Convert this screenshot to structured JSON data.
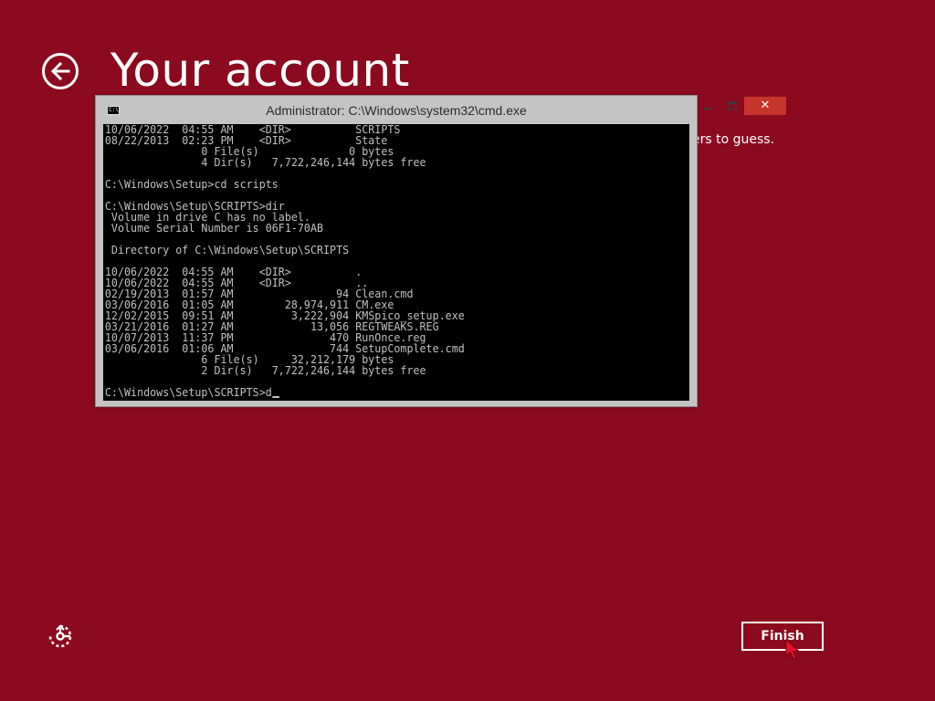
{
  "page": {
    "title": "Your account",
    "behind_text": "ers to guess.",
    "finish_label": "Finish"
  },
  "cmd": {
    "title": "Administrator: C:\\Windows\\system32\\cmd.exe",
    "icon_text": "C:\\",
    "close_glyph": "✕",
    "lines": [
      "10/06/2022  04:55 AM    <DIR>          SCRIPTS",
      "08/22/2013  02:23 PM    <DIR>          State",
      "               0 File(s)              0 bytes",
      "               4 Dir(s)   7,722,246,144 bytes free",
      "",
      "C:\\Windows\\Setup>cd scripts",
      "",
      "C:\\Windows\\Setup\\SCRIPTS>dir",
      " Volume in drive C has no label.",
      " Volume Serial Number is 06F1-70AB",
      "",
      " Directory of C:\\Windows\\Setup\\SCRIPTS",
      "",
      "10/06/2022  04:55 AM    <DIR>          .",
      "10/06/2022  04:55 AM    <DIR>          ..",
      "02/19/2013  01:57 AM                94 Clean.cmd",
      "03/06/2016  01:05 AM        28,974,911 CM.exe",
      "12/02/2015  09:51 AM         3,222,904 KMSpico_setup.exe",
      "03/21/2016  01:27 AM            13,056 REGTWEAKS.REG",
      "10/07/2013  11:37 PM               470 RunOnce.reg",
      "03/06/2016  01:06 AM               744 SetupComplete.cmd",
      "               6 File(s)     32,212,179 bytes",
      "               2 Dir(s)   7,722,246,144 bytes free",
      "",
      "C:\\Windows\\Setup\\SCRIPTS>d"
    ]
  },
  "colors": {
    "background": "#8c0a1e",
    "close_button": "#c7342b",
    "console_bg": "#000000",
    "console_text": "#c0c0c0"
  },
  "icons": {
    "back": "back-arrow-icon",
    "ease_of_access": "ease-of-access-icon",
    "cursor": "mouse-pointer-icon"
  }
}
